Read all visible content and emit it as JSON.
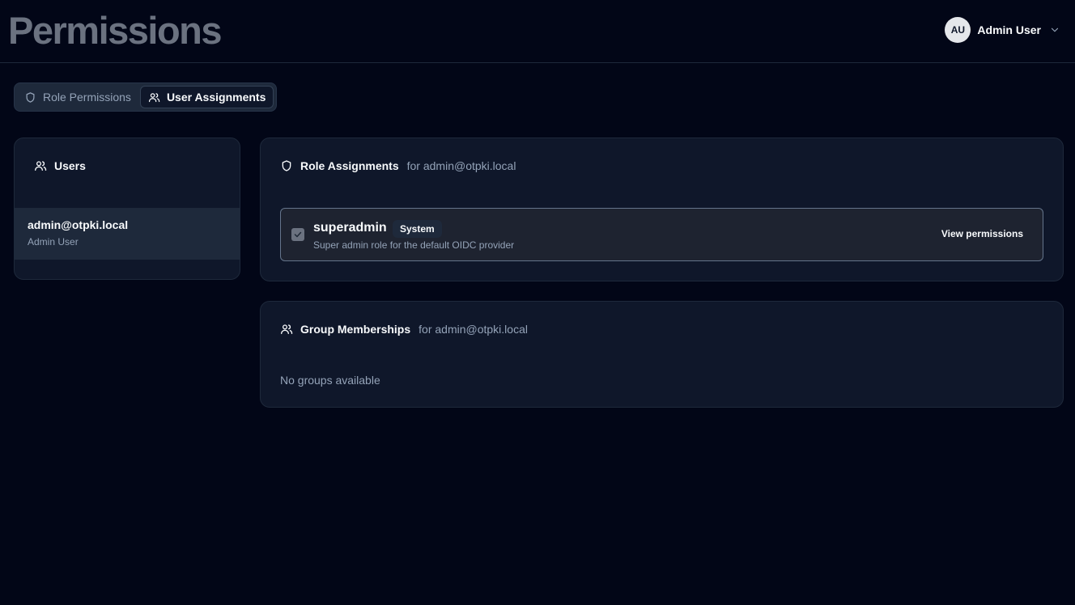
{
  "header": {
    "title": "Permissions",
    "user": {
      "initials": "AU",
      "name": "Admin User"
    }
  },
  "tabs": [
    {
      "label": "Role Permissions",
      "icon": "shield-icon",
      "active": false
    },
    {
      "label": "User Assignments",
      "icon": "users-icon",
      "active": true
    }
  ],
  "users_panel": {
    "title": "Users",
    "users": [
      {
        "email": "admin@otpki.local",
        "name": "Admin User",
        "selected": true
      }
    ]
  },
  "role_assignments": {
    "title": "Role Assignments",
    "subtitle": "for admin@otpki.local",
    "roles": [
      {
        "name": "superadmin",
        "badge": "System",
        "description": "Super admin role for the default OIDC provider",
        "checked": true,
        "action_label": "View permissions"
      }
    ]
  },
  "group_memberships": {
    "title": "Group Memberships",
    "subtitle": "for admin@otpki.local",
    "empty_message": "No groups available"
  },
  "colors": {
    "background": "#020617",
    "card": "#0f172a",
    "border": "#1e293b",
    "muted_text": "#94a3b8",
    "title_gray": "#6b7280"
  }
}
